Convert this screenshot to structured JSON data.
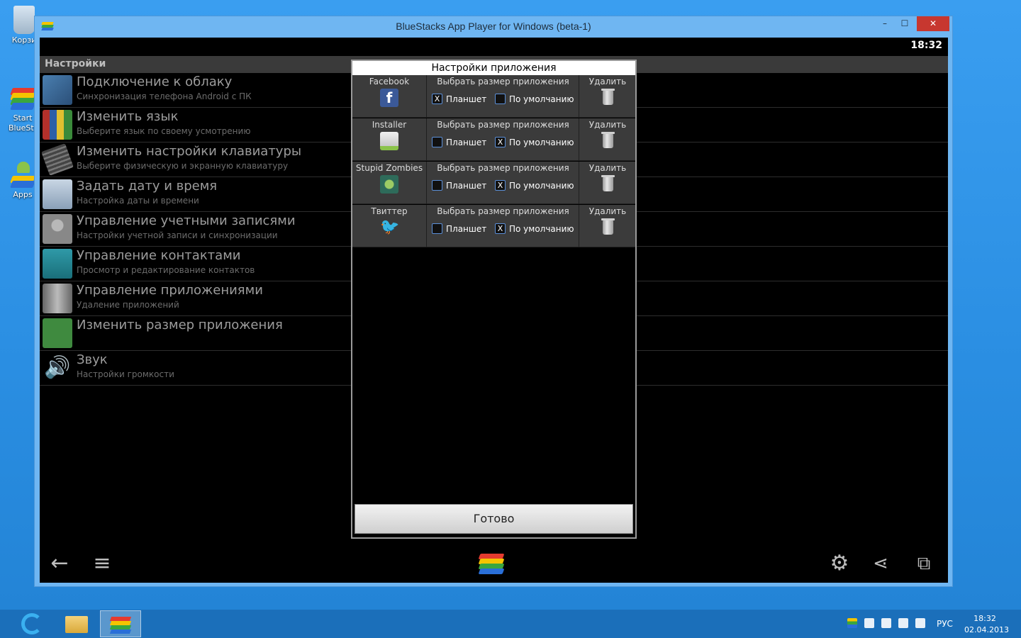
{
  "desktop": {
    "icons": [
      {
        "label": "Корзи"
      },
      {
        "label": "Start BlueSta"
      },
      {
        "label": "Apps"
      }
    ]
  },
  "window": {
    "title": "BlueStacks App Player for Windows (beta-1)",
    "controls": {
      "minimize": "–",
      "maximize": "☐",
      "close": "✕"
    }
  },
  "android": {
    "clock": "18:32",
    "settings_header": "Настройки",
    "settings": [
      {
        "title": "Подключение к облаку",
        "subtitle": "Синхронизация телефона Android с ПК"
      },
      {
        "title": "Изменить язык",
        "subtitle": "Выберите язык по своему усмотрению"
      },
      {
        "title": "Изменить настройки клавиатуры",
        "subtitle": "Выберите физическую и экранную клавиатуру"
      },
      {
        "title": "Задать дату и время",
        "subtitle": "Настройка даты и времени"
      },
      {
        "title": "Управление учетными записями",
        "subtitle": "Настройки учетной записи и синхронизации"
      },
      {
        "title": "Управление контактами",
        "subtitle": "Просмотр и редактирование контактов"
      },
      {
        "title": "Управление приложениями",
        "subtitle": "Удаление приложений"
      },
      {
        "title": "Изменить размер приложения",
        "subtitle": ""
      },
      {
        "title": "Звук",
        "subtitle": "Настройки громкости"
      }
    ]
  },
  "dialog": {
    "title": "Настройки приложения",
    "size_header": "Выбрать размер приложения",
    "delete_label": "Удалить",
    "option_tablet": "Планшет",
    "option_default": "По умолчанию",
    "apps": [
      {
        "name": "Facebook",
        "tablet": true,
        "default": false
      },
      {
        "name": "Installer",
        "tablet": false,
        "default": true
      },
      {
        "name": "Stupid Zombies",
        "tablet": false,
        "default": true
      },
      {
        "name": "Твиттер",
        "tablet": false,
        "default": true
      }
    ],
    "done_label": "Готово"
  },
  "taskbar": {
    "language": "РУС",
    "time": "18:32",
    "date": "02.04.2013"
  },
  "colors": {
    "desktop_bg": "#2b8fe0",
    "close_button": "#c7372f",
    "checkbox_border": "#5b8fd8"
  }
}
